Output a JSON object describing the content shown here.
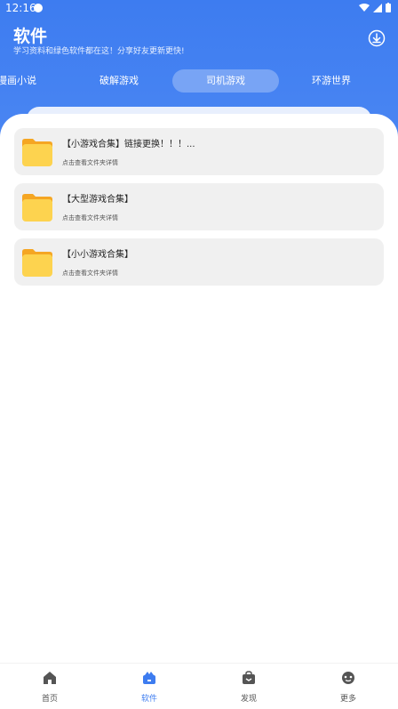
{
  "status_bar": {
    "time": "12:16"
  },
  "header": {
    "title": "软件",
    "subtitle": "学习资料和绿色软件都在这！分享好友更新更快!"
  },
  "tabs": [
    {
      "label": "漫画小说"
    },
    {
      "label": "破解游戏"
    },
    {
      "label": "司机游戏"
    },
    {
      "label": "环游世界"
    }
  ],
  "folders": [
    {
      "title": "【小游戏合集】链接更换！！！...",
      "subtitle": "点击查看文件夹详情"
    },
    {
      "title": "【大型游戏合集】",
      "subtitle": "点击查看文件夹详情"
    },
    {
      "title": "【小小游戏合集】",
      "subtitle": "点击查看文件夹详情"
    }
  ],
  "bottom_nav": [
    {
      "label": "首页",
      "icon": "home-icon"
    },
    {
      "label": "软件",
      "icon": "software-icon"
    },
    {
      "label": "发现",
      "icon": "discover-icon"
    },
    {
      "label": "更多",
      "icon": "more-icon"
    }
  ],
  "colors": {
    "accent": "#3d7cf0",
    "folder": "#fdd34f",
    "card_bg": "#f0f0f0"
  }
}
